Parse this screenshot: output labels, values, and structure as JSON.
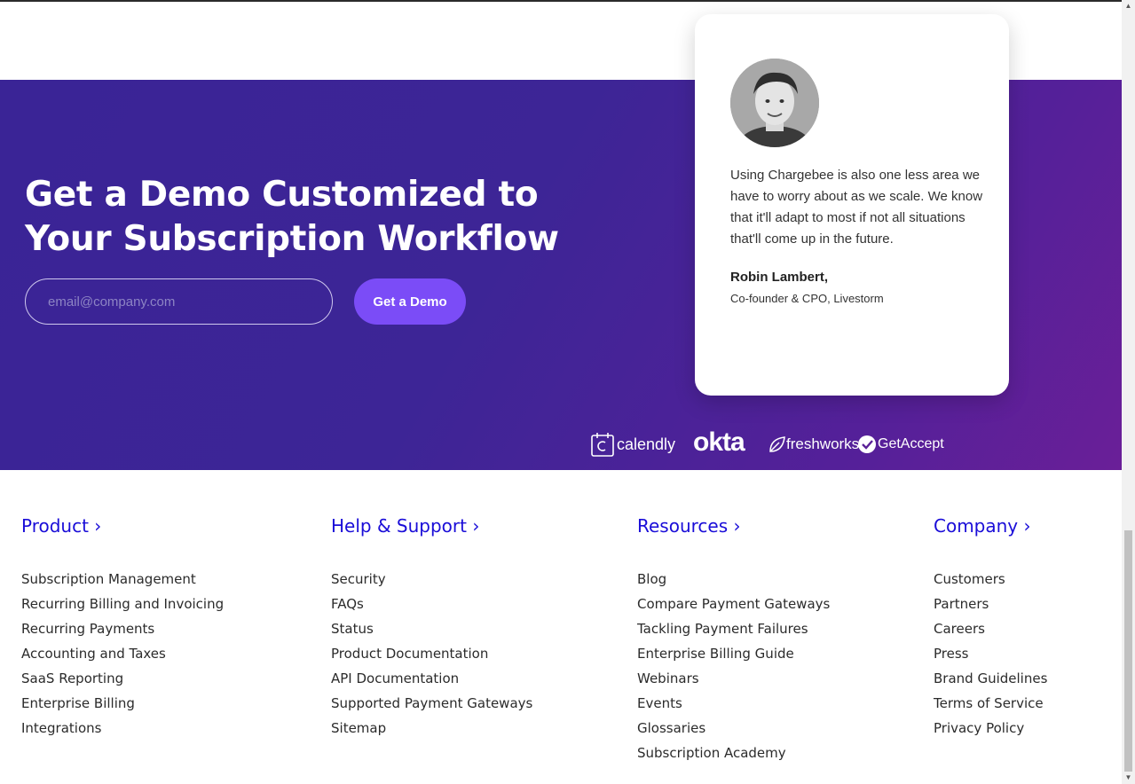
{
  "hero": {
    "title_line1": "Get a Demo Customized to",
    "title_line2": "Your Subscription Workflow",
    "email_placeholder": "email@company.com",
    "cta_label": "Get a Demo"
  },
  "testimonial": {
    "quote": "Using Chargebee is also one less area we have to worry about as we scale. We know that it'll adapt to most if not all situations that'll come up in the future.",
    "name": "Robin Lambert,",
    "role": "Co-founder & CPO, Livestorm"
  },
  "logos": {
    "calendly": "calendly",
    "okta": "okta",
    "freshworks": "freshworks",
    "getaccept": "GetAccept"
  },
  "footer": {
    "product": {
      "heading": "Product ›",
      "links": [
        "Subscription Management",
        "Recurring Billing and Invoicing",
        "Recurring Payments",
        "Accounting and Taxes",
        "SaaS Reporting",
        "Enterprise Billing",
        "Integrations"
      ]
    },
    "help": {
      "heading": "Help & Support ›",
      "links": [
        "Security",
        "FAQs",
        "Status",
        "Product Documentation",
        "API Documentation",
        "Supported Payment Gateways",
        "Sitemap"
      ]
    },
    "resources": {
      "heading": "Resources ›",
      "links": [
        "Blog",
        "Compare Payment Gateways",
        "Tackling Payment Failures",
        "Enterprise Billing Guide",
        "Webinars",
        "Events",
        "Glossaries",
        "Subscription Academy"
      ]
    },
    "company": {
      "heading": "Company ›",
      "links": [
        "Customers",
        "Partners",
        "Careers",
        "Press",
        "Brand Guidelines",
        "Terms of Service",
        "Privacy Policy"
      ]
    }
  },
  "colors": {
    "accent": "#7b4cf7",
    "footer_heading": "#1a0dd8",
    "hero_bg_start": "#3a2496",
    "hero_bg_end": "#6a1f98"
  }
}
